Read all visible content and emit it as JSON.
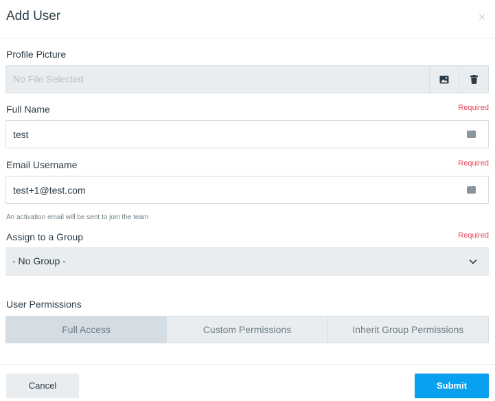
{
  "dialog": {
    "title": "Add User",
    "close_symbol": "×"
  },
  "profile_picture": {
    "label": "Profile Picture",
    "placeholder": "No File Selected",
    "upload_icon": "image-icon",
    "delete_icon": "trash-icon"
  },
  "full_name": {
    "label": "Full Name",
    "required": "Required",
    "value": "test",
    "icon": "keyboard-icon"
  },
  "email": {
    "label": "Email Username",
    "required": "Required",
    "value": "test+1@test.com",
    "icon": "keyboard-icon",
    "hint": "An activation email will be sent to join the team"
  },
  "group": {
    "label": "Assign to a Group",
    "required": "Required",
    "selected": "- No Group -",
    "icon": "chevron-down-icon"
  },
  "permissions": {
    "label": "User Permissions",
    "options": [
      "Full Access",
      "Custom Permissions",
      "Inherit Group Permissions"
    ],
    "selected": "Full Access"
  },
  "footer": {
    "cancel_label": "Cancel",
    "submit_label": "Submit"
  },
  "colors": {
    "accent": "#0aa0f0",
    "required": "#e5495d",
    "field_bg": "#e9edef"
  }
}
